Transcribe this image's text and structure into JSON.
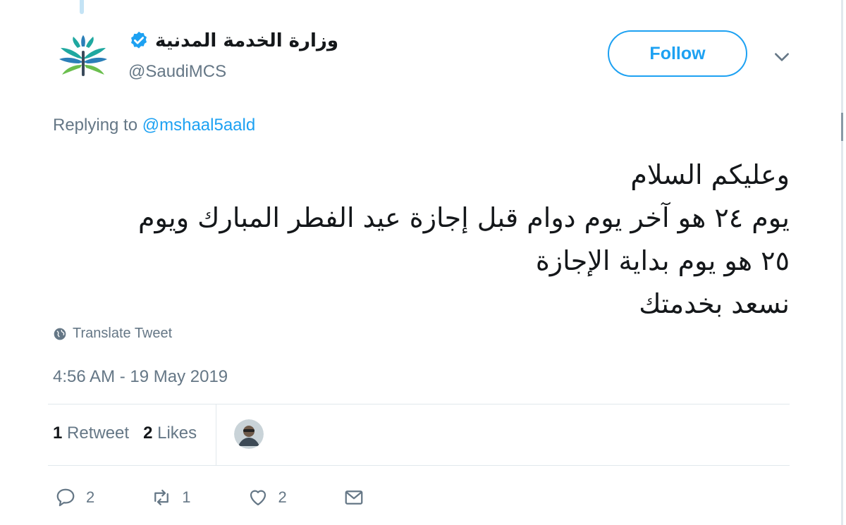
{
  "account": {
    "display_name": "وزارة الخدمة المدنية",
    "handle": "@SaudiMCS",
    "verified": true
  },
  "follow_label": "Follow",
  "reply": {
    "prefix": "Replying to ",
    "mention": "@mshaal5aald"
  },
  "tweet": {
    "lines": [
      "وعليكم السلام",
      "يوم ٢٤ هو آخر يوم دوام قبل إجازة عيد الفطر المبارك ويوم",
      "٢٥ هو يوم بداية الإجازة",
      "نسعد بخدمتك"
    ]
  },
  "translate_label": "Translate Tweet",
  "timestamp": "4:56 AM - 19 May 2019",
  "stats": {
    "retweets_count": "1",
    "retweets_label": "Retweet",
    "likes_count": "2",
    "likes_label": "Likes"
  },
  "actions": {
    "reply_count": "2",
    "retweet_count": "1",
    "like_count": "2"
  },
  "colors": {
    "accent": "#1da1f2",
    "muted": "#657786",
    "text": "#14171a",
    "divider": "#e1e8ed"
  },
  "icons": [
    "verified-badge-icon",
    "chevron-down-icon",
    "globe-icon",
    "reply-icon",
    "retweet-icon",
    "like-icon",
    "message-icon"
  ]
}
